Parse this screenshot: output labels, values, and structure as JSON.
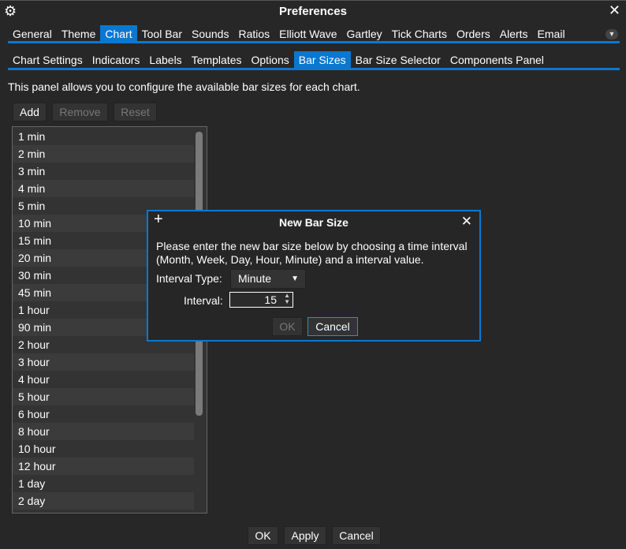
{
  "window": {
    "title": "Preferences"
  },
  "main_tabs": [
    "General",
    "Theme",
    "Chart",
    "Tool Bar",
    "Sounds",
    "Ratios",
    "Elliott Wave",
    "Gartley",
    "Tick Charts",
    "Orders",
    "Alerts",
    "Email"
  ],
  "main_active": "Chart",
  "sub_tabs": [
    "Chart Settings",
    "Indicators",
    "Labels",
    "Templates",
    "Options",
    "Bar Sizes",
    "Bar Size Selector",
    "Components Panel"
  ],
  "sub_active": "Bar Sizes",
  "description": "This panel allows you to configure the available bar sizes for each chart.",
  "toolbar": {
    "add": "Add",
    "remove": "Remove",
    "reset": "Reset"
  },
  "bar_sizes": [
    "1 min",
    "2 min",
    "3 min",
    "4 min",
    "5 min",
    "10 min",
    "15 min",
    "20 min",
    "30 min",
    "45 min",
    "1 hour",
    "90 min",
    "2 hour",
    "3 hour",
    "4 hour",
    "5 hour",
    "6 hour",
    "8 hour",
    "10 hour",
    "12 hour",
    "1 day",
    "2 day"
  ],
  "dialog": {
    "title": "New Bar Size",
    "message": "Please enter the new bar size below by choosing a time interval (Month, Week, Day, Hour, Minute) and a interval value.",
    "interval_type_label": "Interval Type:",
    "interval_type_value": "Minute",
    "interval_label": "Interval:",
    "interval_value": "15",
    "ok": "OK",
    "cancel": "Cancel"
  },
  "footer": {
    "ok": "OK",
    "apply": "Apply",
    "cancel": "Cancel"
  },
  "colors": {
    "accent": "#0a78d0",
    "background": "#272727"
  }
}
